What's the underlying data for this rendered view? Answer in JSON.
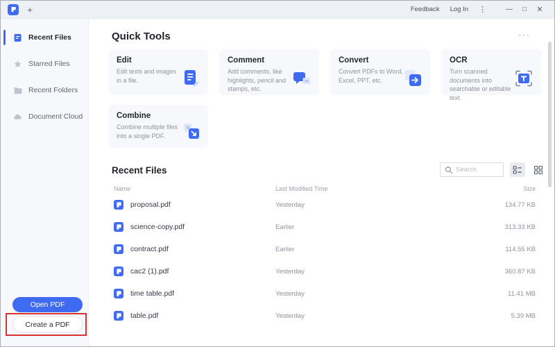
{
  "tab_bar": {
    "new_tab": "+",
    "feedback": "Feedback",
    "log_in": "Log In",
    "menu": "⋮",
    "minimize": "—",
    "maximize": "□",
    "close": "✕"
  },
  "sidebar": {
    "items": [
      {
        "label": "Recent Files",
        "icon": "recent-files-icon",
        "active": true
      },
      {
        "label": "Starred Files",
        "icon": "star-icon",
        "active": false
      },
      {
        "label": "Recent Folders",
        "icon": "folder-icon",
        "active": false
      },
      {
        "label": "Document Cloud",
        "icon": "cloud-icon",
        "active": false
      }
    ],
    "open_pdf": "Open PDF",
    "create_pdf": "Create a PDF"
  },
  "quick_tools": {
    "title": "Quick Tools",
    "more": "···",
    "cards": [
      {
        "title": "Edit",
        "description": "Edit texts and images in a file.",
        "icon": "edit-document-icon"
      },
      {
        "title": "Comment",
        "description": "Add comments, like highlights, pencil and stamps, etc.",
        "icon": "comment-bubble-icon"
      },
      {
        "title": "Convert",
        "description": "Convert PDFs to Word, Excel, PPT, etc.",
        "icon": "convert-arrow-icon"
      },
      {
        "title": "OCR",
        "description": "Turn scanned documents into searchable or editable text.",
        "icon": "ocr-scan-icon"
      },
      {
        "title": "Combine",
        "description": "Combine multiple files into a single PDF.",
        "icon": "combine-files-icon"
      }
    ]
  },
  "recent_files": {
    "title": "Recent Files",
    "search_placeholder": "Search",
    "columns": {
      "name": "Name",
      "modified": "Last Modified Time",
      "size": "Size"
    },
    "rows": [
      {
        "name": "proposal.pdf",
        "modified": "Yesterday",
        "size": "134.77 KB"
      },
      {
        "name": "science-copy.pdf",
        "modified": "Earlier",
        "size": "313.33 KB"
      },
      {
        "name": "contract.pdf",
        "modified": "Earlier",
        "size": "114.55 KB"
      },
      {
        "name": "cac2 (1).pdf",
        "modified": "Yesterday",
        "size": "360.87 KB"
      },
      {
        "name": "time table.pdf",
        "modified": "Yesterday",
        "size": "11.41 MB"
      },
      {
        "name": "table.pdf",
        "modified": "Yesterday",
        "size": "5.39 MB"
      }
    ]
  },
  "icons": {
    "app-logo-icon": "blue rounded square with white P",
    "pdf-file-icon": "blue rounded square with white P",
    "search-icon": "magnifier",
    "list-view-icon": "checklist rows",
    "grid-view-icon": "four squares"
  },
  "colors": {
    "accent": "#3e6bf2",
    "annotation_red": "#d93030",
    "sidebar_bg": "#f7f8fb",
    "card_bg": "#f7f8fc",
    "tabbar_bg": "#edf0f5"
  }
}
